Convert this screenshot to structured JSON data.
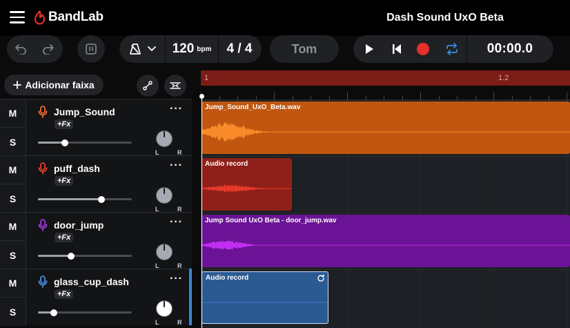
{
  "header": {
    "app_name": "BandLab",
    "project_title": "Dash Sound UxO Beta"
  },
  "toolbar": {
    "bpm_value": "120",
    "bpm_unit": "bpm",
    "time_signature": "4 / 4",
    "key_label": "Tom",
    "timecode": "00:00.0"
  },
  "tracks_panel": {
    "add_track_label": "Adicionar faixa"
  },
  "tracks": [
    {
      "name": "Jump_Sound",
      "fx": "+Fx",
      "mute": "M",
      "solo": "S",
      "mic_color": "#f26a2e",
      "volume": 0.29,
      "knob_color": "#a6abb3",
      "selected": false
    },
    {
      "name": "puff_dash",
      "fx": "+Fx",
      "mute": "M",
      "solo": "S",
      "mic_color": "#e5402c",
      "volume": 0.68,
      "knob_color": "#a6abb3",
      "selected": false
    },
    {
      "name": "door_jump",
      "fx": "+Fx",
      "mute": "M",
      "solo": "S",
      "mic_color": "#a03ad9",
      "volume": 0.35,
      "knob_color": "#a6abb3",
      "selected": false
    },
    {
      "name": "glass_cup_dash",
      "fx": "+Fx",
      "mute": "M",
      "solo": "S",
      "mic_color": "#4a8fe0",
      "volume": 0.17,
      "knob_color": "#ffffff",
      "selected": true
    }
  ],
  "timeline": {
    "ruler_labels": [
      "1",
      "1.2"
    ],
    "clips": [
      {
        "label": "Jump_Sound_UxO_Beta.wav",
        "color": "#c0560f",
        "wave_color": "#f88a2a"
      },
      {
        "label": "Audio record",
        "color": "#8f2019",
        "wave_color": "#e6392a"
      },
      {
        "label": "Jump Sound UxO Beta - door_jump.wav",
        "color": "#6b1396",
        "wave_color": "#c02ff0"
      },
      {
        "label": "Audio record",
        "color": "#2b5a92",
        "wave_color": "#3b7bc4"
      }
    ]
  },
  "colors": {
    "accent_red": "#e5302c",
    "loop_blue": "#3a8ee0",
    "brand": "#e5302c"
  }
}
